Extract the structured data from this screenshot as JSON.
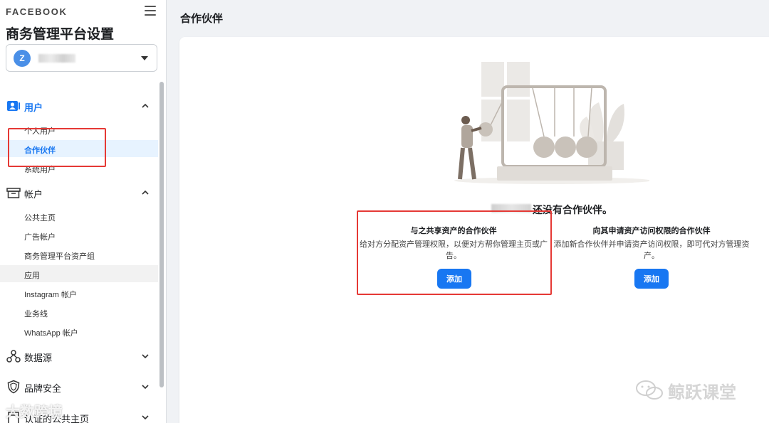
{
  "sidebar": {
    "brand": "FACEBOOK",
    "title": "商务管理平台设置",
    "account": {
      "avatar_letter": "Z"
    },
    "sections": [
      {
        "label": "用户",
        "icon": "users-icon",
        "expanded": true,
        "items": [
          "个人用户",
          "合作伙伴",
          "系统用户"
        ]
      },
      {
        "label": "帐户",
        "icon": "archive-icon",
        "expanded": true,
        "items": [
          "公共主页",
          "广告帐户",
          "商务管理平台资产组",
          "应用",
          "Instagram 帐户",
          "业务线",
          "WhatsApp 帐户"
        ]
      },
      {
        "label": "数据源",
        "icon": "data-sources-icon",
        "expanded": false
      },
      {
        "label": "品牌安全",
        "icon": "shield-icon",
        "expanded": false
      },
      {
        "label": "认证的公共主页",
        "icon": "verified-page-icon",
        "expanded": false
      }
    ],
    "active_item": "合作伙伴",
    "watermark": "大数跨境"
  },
  "main": {
    "page_title": "合作伙伴",
    "empty_message": "还没有合作伙伴。",
    "options": [
      {
        "title": "与之共享资产的合作伙伴",
        "description": "给对方分配资产管理权限，以便对方帮你管理主页或广告。",
        "button": "添加"
      },
      {
        "title": "向其申请资产访问权限的合作伙伴",
        "description": "添加新合作伙伴并申请资产访问权限，即可代对方管理资产。",
        "button": "添加"
      }
    ],
    "watermark": "鲸跃课堂"
  },
  "colors": {
    "accent": "#1877f2",
    "highlight_box": "#e53935",
    "active_bg": "#e7f3ff"
  }
}
